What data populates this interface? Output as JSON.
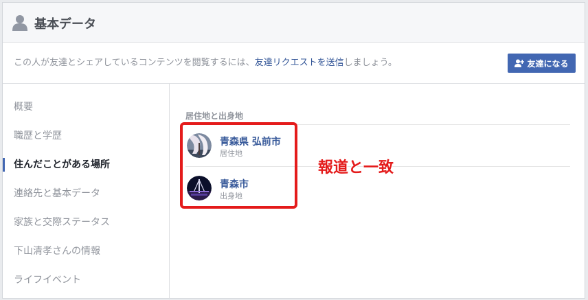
{
  "header": {
    "title": "基本データ",
    "icon": "person-icon"
  },
  "notice": {
    "prefix": "この人が友達とシェアしているコンテンツを閲覧するには、",
    "link": "友達リクエストを送信",
    "suffix": "しましょう。",
    "button_label": "友達になる",
    "button_icon": "add-friend-icon"
  },
  "sidebar": {
    "items": [
      {
        "label": "概要"
      },
      {
        "label": "職歴と学歴"
      },
      {
        "label": "住んだことがある場所",
        "active": true
      },
      {
        "label": "連絡先と基本データ"
      },
      {
        "label": "家族と交際ステータス"
      },
      {
        "label": "下山清孝さんの情報"
      },
      {
        "label": "ライフイベント"
      }
    ]
  },
  "places": {
    "section_title": "居住地と出身地",
    "items": [
      {
        "name": "青森県 弘前市",
        "type": "居住地",
        "thumb": "cherry-blossom-photo"
      },
      {
        "name": "青森市",
        "type": "出身地",
        "thumb": "night-bridge-photo"
      }
    ]
  },
  "annotation": {
    "text": "報道と一致",
    "color": "#e41b1b"
  },
  "colors": {
    "accent": "#4267b2",
    "link": "#365899",
    "muted": "#90949c",
    "annotation": "#e41b1b"
  }
}
